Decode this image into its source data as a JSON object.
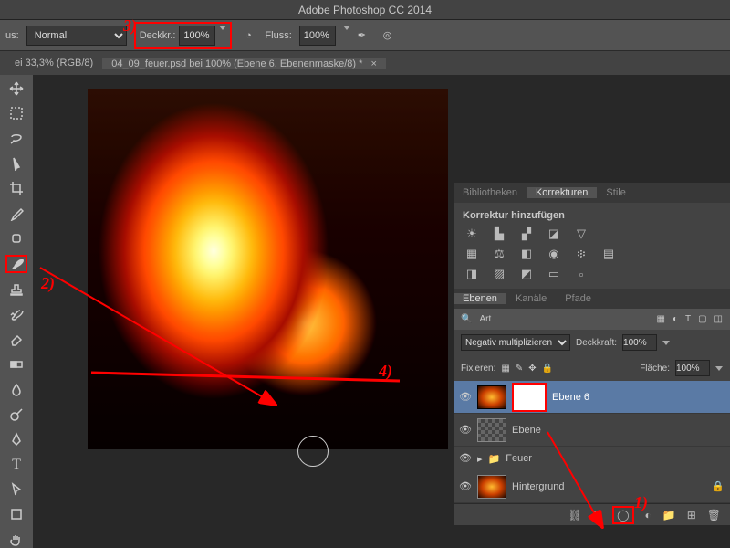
{
  "app_title": "Adobe Photoshop CC 2014",
  "options_bar": {
    "mode_label": "us:",
    "mode_value": "Normal",
    "opacity_label": "Deckkr.:",
    "opacity_value": "100%",
    "flow_label": "Fluss:",
    "flow_value": "100%"
  },
  "tabs": {
    "tab1": "ei 33,3% (RGB/8)",
    "tab2": "04_09_feuer.psd bei 100% (Ebene 6, Ebenenmaske/8) *"
  },
  "panels": {
    "korrekturen": {
      "tab_bibliotheken": "Bibliotheken",
      "tab_korrekturen": "Korrekturen",
      "tab_stile": "Stile",
      "heading": "Korrektur hinzufügen"
    },
    "ebenen": {
      "tab_ebenen": "Ebenen",
      "tab_kanäle": "Kanäle",
      "tab_pfade": "Pfade",
      "filter_label": "Art",
      "blend_value": "Negativ multiplizieren",
      "deckkraft_label": "Deckkraft:",
      "deckkraft_value": "100%",
      "fixieren_label": "Fixieren:",
      "fläche_label": "Fläche:",
      "fläche_value": "100%",
      "layer1_name": "Ebene 6",
      "layer2_name": "Ebene",
      "folder_name": "Feuer",
      "bg_name": "Hintergrund"
    }
  },
  "annotations": {
    "n1": "1)",
    "n2": "2)",
    "n3": "3)",
    "n4": "4)"
  }
}
